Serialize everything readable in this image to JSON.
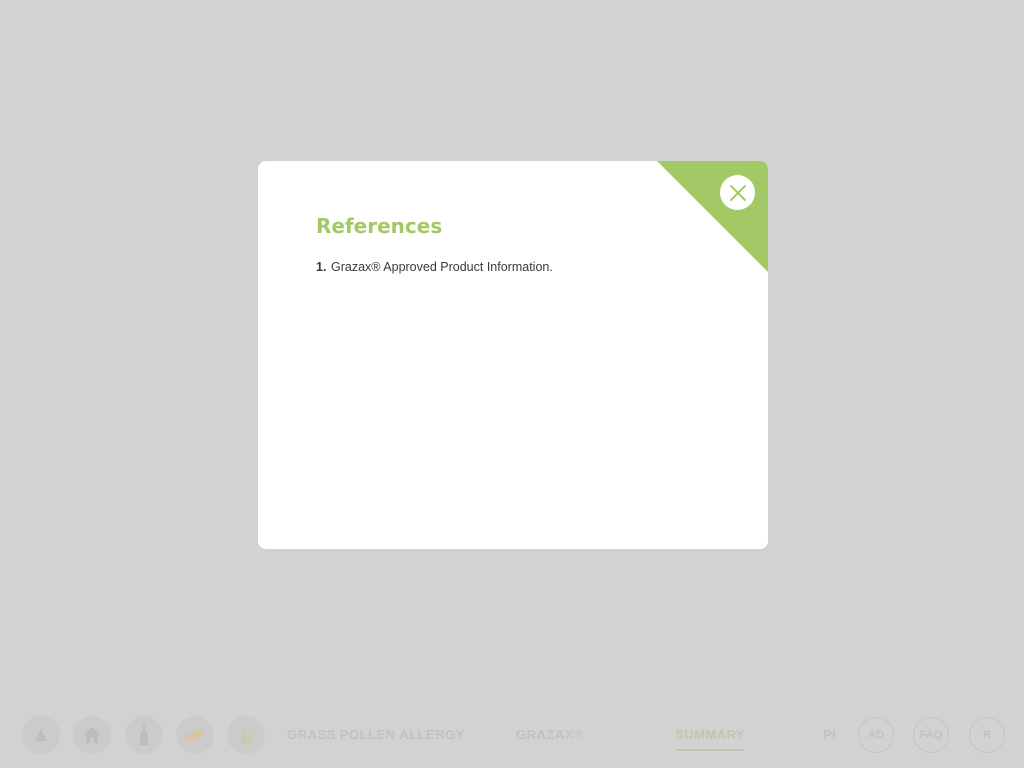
{
  "nav": {
    "icons": [
      "up-arrow-icon",
      "home-icon",
      "bottle-icon",
      "leaf-icon",
      "grass-icon"
    ],
    "section_1": "GRASS POLLEN ALLERGY",
    "section_2": "GRAZAX®",
    "section_3": "SUMMARY",
    "pi_label": "PI",
    "circle_1": "AD",
    "circle_2": "FAQ",
    "circle_3": "R"
  },
  "modal": {
    "title": "References",
    "references": [
      {
        "number": "1.",
        "text": "Grazax® Approved Product Information."
      }
    ]
  },
  "colors": {
    "accent": "#a2c966",
    "overlay": "#d2d2d2",
    "modal_bg": "#ffffff"
  }
}
